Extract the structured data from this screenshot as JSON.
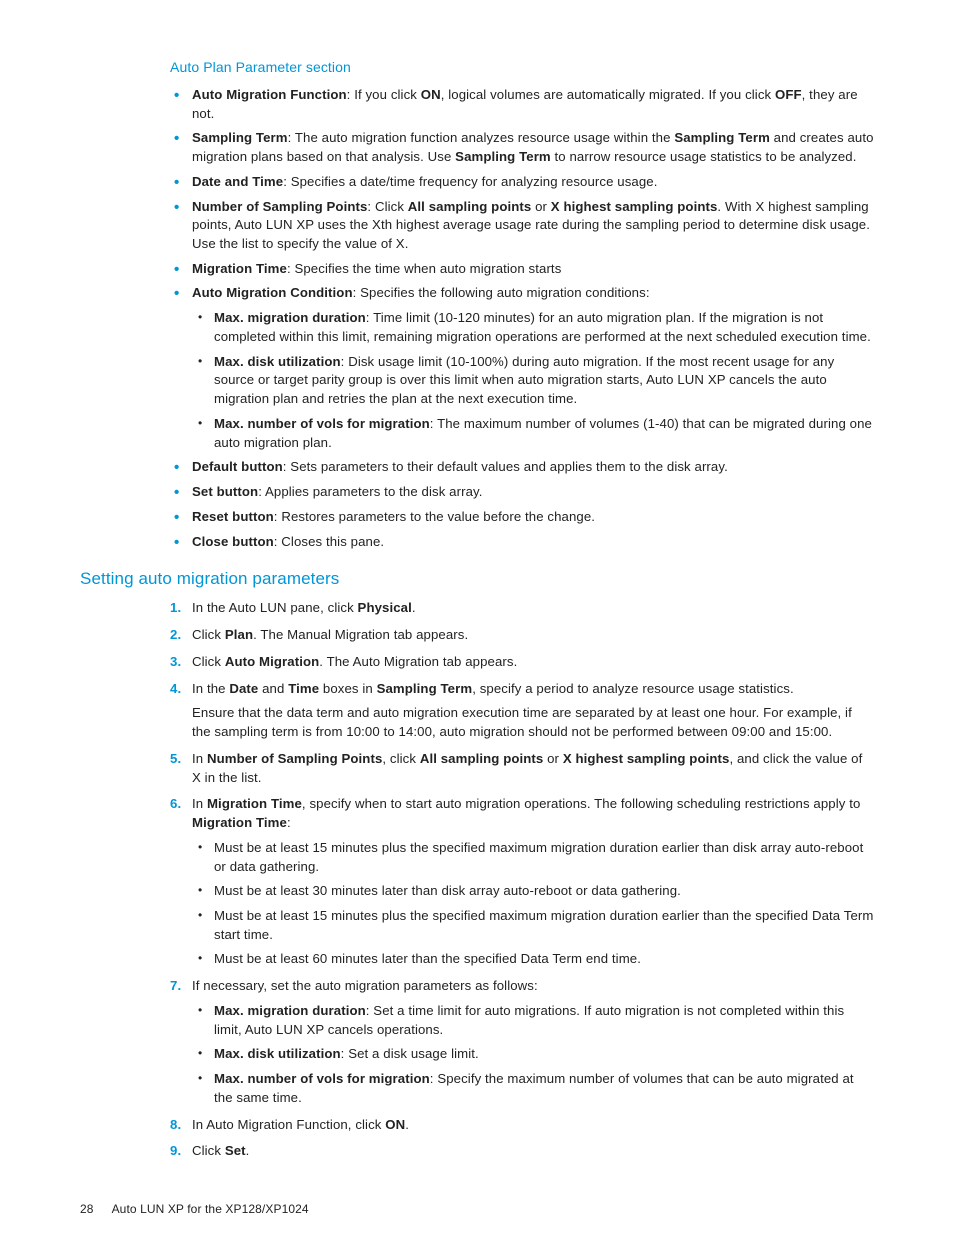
{
  "heading1": "Auto Plan Parameter section",
  "params": {
    "b1_lead": "Auto Migration Function",
    "b1_t1": ": If you click ",
    "b1_on": "ON",
    "b1_t2": ", logical volumes are automatically migrated. If you click ",
    "b1_off": "OFF",
    "b1_t3": ", they are not.",
    "b2_lead": "Sampling Term",
    "b2_t1": ": The auto migration function analyzes resource usage within the ",
    "b2_st1": "Sampling Term",
    "b2_t2": " and creates auto migration plans based on that analysis. Use ",
    "b2_st2": "Sampling Term",
    "b2_t3": " to narrow resource usage statistics to be analyzed.",
    "b3_lead": "Date and Time",
    "b3_t": ": Specifies a date/time frequency for analyzing resource usage.",
    "b4_lead": "Number of Sampling Points",
    "b4_t1": ": Click ",
    "b4_all": "All sampling points",
    "b4_or": " or ",
    "b4_x": "X highest sampling points",
    "b4_t2": ". With X highest sampling points, Auto LUN XP uses the Xth highest average usage rate during the sampling period to determine disk usage. Use the list to specify the value of X.",
    "b5_lead": "Migration Time",
    "b5_t": ": Specifies the time when auto migration starts",
    "b6_lead": "Auto Migration Condition",
    "b6_t": ": Specifies the following auto migration conditions:",
    "b6_s1_lead": "Max. migration duration",
    "b6_s1_t": ": Time limit (10-120 minutes) for an auto migration plan. If the migration is not completed within this limit, remaining migration operations are performed at the next scheduled execution time.",
    "b6_s2_lead": "Max. disk utilization",
    "b6_s2_t": ": Disk usage limit (10-100%) during auto migration. If the most recent usage for any source or target parity group is over this limit when auto migration starts, Auto LUN XP cancels the auto migration plan and retries the plan at the next execution time.",
    "b6_s3_lead": "Max. number of vols for migration",
    "b6_s3_t": ": The maximum number of volumes (1-40) that can be migrated during one auto migration plan.",
    "b7_lead": "Default button",
    "b7_t": ": Sets parameters to their default values and applies them to the disk array.",
    "b8_lead": "Set button",
    "b8_t": ": Applies parameters to the disk array.",
    "b9_lead": "Reset button",
    "b9_t": ": Restores parameters to the value before the change.",
    "b10_lead": "Close button",
    "b10_t": ": Closes this pane."
  },
  "heading2": "Setting auto migration parameters",
  "steps": {
    "s1_t1": "In the Auto LUN pane, click ",
    "s1_b": "Physical",
    "s1_t2": ".",
    "s2_t1": "Click ",
    "s2_b": "Plan",
    "s2_t2": ". The Manual Migration tab appears.",
    "s3_t1": "Click ",
    "s3_b": "Auto Migration",
    "s3_t2": ". The Auto Migration tab appears.",
    "s4_t1": "In the ",
    "s4_b1": "Date",
    "s4_t2": " and ",
    "s4_b2": "Time",
    "s4_t3": " boxes in ",
    "s4_b3": "Sampling Term",
    "s4_t4": ", specify a period to analyze resource usage statistics.",
    "s4_p": "Ensure that the data term and auto migration execution time are separated by at least one hour. For example, if the sampling term is from 10:00 to 14:00, auto migration should not be performed between 09:00 and 15:00.",
    "s5_t1": "In ",
    "s5_b1": "Number of Sampling Points",
    "s5_t2": ", click ",
    "s5_b2": "All sampling points",
    "s5_t3": " or ",
    "s5_b3": "X highest sampling points",
    "s5_t4": ", and click the value of X in the list.",
    "s6_t1": "In ",
    "s6_b1": "Migration Time",
    "s6_t2": ", specify when to start auto migration operations. The following scheduling restrictions apply to ",
    "s6_b2": "Migration Time",
    "s6_t3": ":",
    "s6_sub1": "Must be at least 15 minutes plus the specified maximum migration duration earlier than disk array auto-reboot or data gathering.",
    "s6_sub2": "Must be at least 30 minutes later than disk array auto-reboot or data gathering.",
    "s6_sub3": "Must be at least 15 minutes plus the specified maximum migration duration earlier than the specified Data Term start time.",
    "s6_sub4": "Must be at least 60 minutes later than the specified Data Term end time.",
    "s7_t": "If necessary, set the auto migration parameters as follows:",
    "s7_s1_b": "Max. migration duration",
    "s7_s1_t": ": Set a time limit for auto migrations. If auto migration is not completed within this limit, Auto LUN XP cancels operations.",
    "s7_s2_b": "Max. disk utilization",
    "s7_s2_t": ": Set a disk usage limit.",
    "s7_s3_b": "Max. number of vols for migration",
    "s7_s3_t": ": Specify the maximum number of volumes that can be auto migrated at the same time.",
    "s8_t1": "In Auto Migration Function, click ",
    "s8_b": "ON",
    "s8_t2": ".",
    "s9_t1": "Click ",
    "s9_b": "Set",
    "s9_t2": "."
  },
  "footer": {
    "page": "28",
    "title": "Auto LUN XP for the XP128/XP1024"
  }
}
